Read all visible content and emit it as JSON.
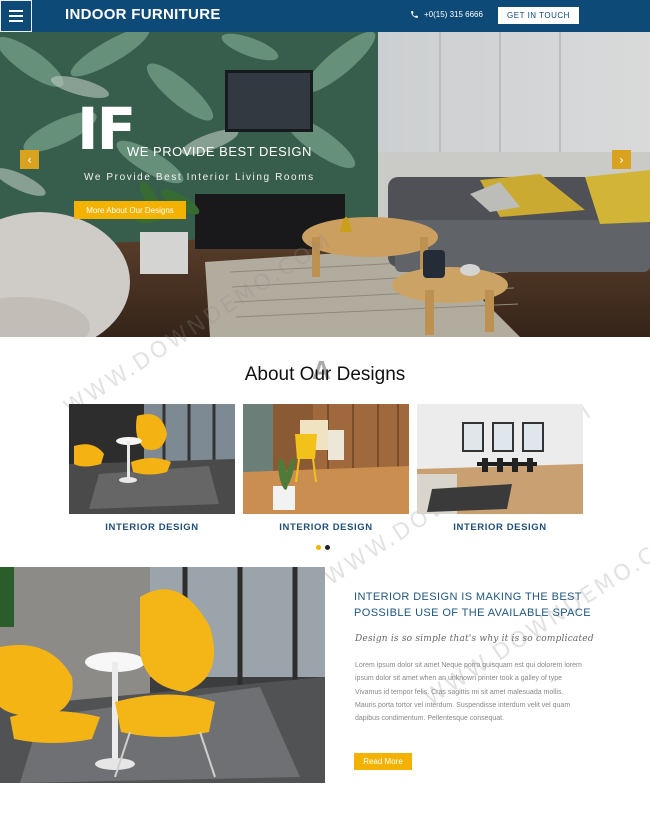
{
  "header": {
    "brand": "INDOOR FURNITURE",
    "phone": "+0(15) 315 6666",
    "cta_label": "GET IN TOUCH",
    "bg_color": "#0d4a78"
  },
  "hero": {
    "big_letters": "IF",
    "title": "WE PROVIDE BEST DESIGN",
    "subtitle": "We Provide Best Interior Living Rooms",
    "button_label": "More About Our Designs",
    "prev_icon": "chevron-left-icon",
    "next_icon": "chevron-right-icon",
    "accent_color": "#f3b200"
  },
  "about": {
    "deco_letter": "A",
    "title": "About Our Designs",
    "cards": [
      {
        "label": "INTERIOR DESIGN"
      },
      {
        "label": "INTERIOR DESIGN"
      },
      {
        "label": "INTERIOR DESIGN"
      }
    ],
    "pagination": {
      "count": 2,
      "active": 1
    }
  },
  "feature": {
    "heading": "INTERIOR DESIGN IS MAKING THE BEST POSSIBLE USE OF THE AVAILABLE SPACE",
    "quote": "Design is so simple that's why it is so complicated",
    "body": "Lorem ipsum dolor sit amet Neque porro quisquam est qui dolorem lorem ipsum dolor sit amet when an unknown printer took a galley of type Vivamus id tempor felis. Cras sagittis mi sit amet malesuada mollis. Mauris porta tortor vel interdum. Suspendisse interdum velit vel quam dapibus condimentum. Pellentesque consequat.",
    "button_label": "Read More"
  },
  "watermark": "WWW.DOWNDEMO.COM"
}
